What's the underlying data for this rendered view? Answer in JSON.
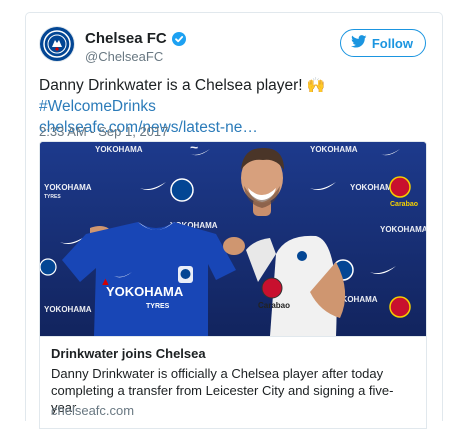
{
  "tweet": {
    "author": {
      "display_name": "Chelsea FC",
      "handle": "@ChelseaFC",
      "verified": true,
      "avatar_icon": "chelsea-crest-icon"
    },
    "follow_label": "Follow",
    "text_main": "Danny Drinkwater is a Chelsea player! ",
    "emoji": "🙌",
    "hashtag": "#WelcomeDrinks",
    "link": "chelseafc.com/news/latest-ne…",
    "timestamp": "2:33 AM - Sep 1, 2017"
  },
  "photo": {
    "sponsor_board_left": "YOKOHAMA",
    "sponsor_board_sub": "TYRES",
    "shirt_sponsor": "YOKOHAMA",
    "shirt_sponsor_sub": "TYRES",
    "shirt_partner": "Carabao",
    "board_partner": "Carabao"
  },
  "link_card": {
    "title": "Drinkwater joins Chelsea",
    "description": "Danny Drinkwater is officially a Chelsea player after today completing a transfer from Leicester City and signing a five-year",
    "domain": "chelseafc.com"
  },
  "colors": {
    "chelsea_blue": "#034694",
    "twitter_blue": "#1b95e0",
    "link_blue": "#2b7bb9",
    "secondary_text": "#697882"
  }
}
